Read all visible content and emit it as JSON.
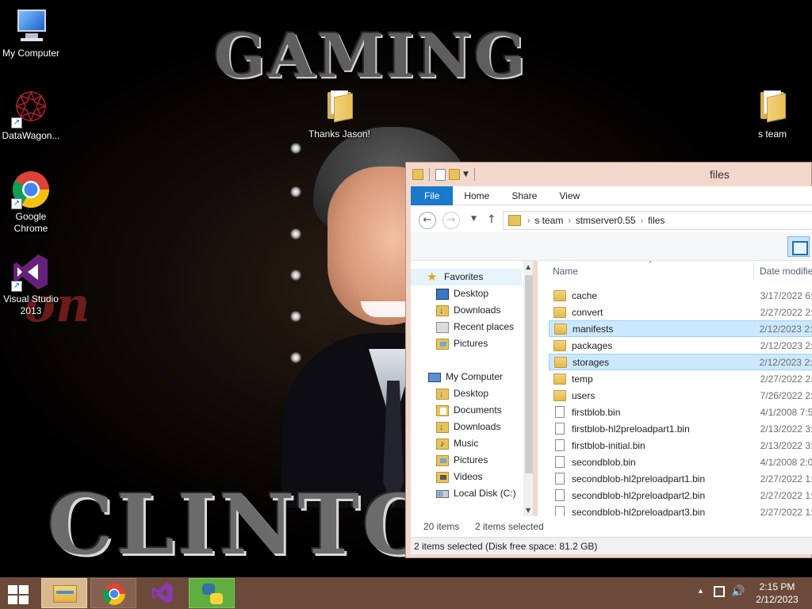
{
  "desktop": {
    "icons": [
      {
        "label": "My Computer",
        "icon": "my-computer-icon"
      },
      {
        "label": "DataWagon...",
        "icon": "datawagon-icon"
      },
      {
        "label": "Google Chrome",
        "icon": "chrome-icon"
      },
      {
        "label": "Visual Studio 2013",
        "icon": "visual-studio-icon"
      },
      {
        "label": "Thanks Jason!",
        "icon": "folder-icon"
      },
      {
        "label": "s team",
        "icon": "folder-icon"
      }
    ],
    "wallpaper_top_text": "GAMING",
    "wallpaper_bottom_text": "CLINTON TEAM",
    "wallpaper_script_text": "on"
  },
  "explorer": {
    "title": "files",
    "ribbon_tabs": [
      "File",
      "Home",
      "Share",
      "View"
    ],
    "breadcrumb": [
      "s team",
      "stmserver0.55",
      "files"
    ],
    "nav_pane": {
      "favorites_label": "Favorites",
      "favorites": [
        "Desktop",
        "Downloads",
        "Recent places",
        "Pictures"
      ],
      "computer_label": "My Computer",
      "computer": [
        "Desktop",
        "Documents",
        "Downloads",
        "Music",
        "Pictures",
        "Videos",
        "Local Disk (C:)"
      ]
    },
    "columns": {
      "name": "Name",
      "date": "Date modifie"
    },
    "files": [
      {
        "name": "cache",
        "date": "3/17/2022 6:3",
        "type": "folder",
        "selected": false
      },
      {
        "name": "convert",
        "date": "2/27/2022 2:1",
        "type": "folder",
        "selected": false
      },
      {
        "name": "manifests",
        "date": "2/12/2023 2:1",
        "type": "folder",
        "selected": true
      },
      {
        "name": "packages",
        "date": "2/12/2023 2:1",
        "type": "folder",
        "selected": false
      },
      {
        "name": "storages",
        "date": "2/12/2023 2:1",
        "type": "folder",
        "selected": true
      },
      {
        "name": "temp",
        "date": "2/27/2022 2:1",
        "type": "folder",
        "selected": false
      },
      {
        "name": "users",
        "date": "7/26/2022 2:4",
        "type": "folder",
        "selected": false
      },
      {
        "name": "firstblob.bin",
        "date": "4/1/2008 7:53",
        "type": "file",
        "selected": false
      },
      {
        "name": "firstblob-hl2preloadpart1.bin",
        "date": "2/13/2022 3:3",
        "type": "file",
        "selected": false
      },
      {
        "name": "firstblob-initial.bin",
        "date": "2/13/2022 3:3",
        "type": "file",
        "selected": false
      },
      {
        "name": "secondblob.bin",
        "date": "4/1/2008 2:01",
        "type": "file",
        "selected": false
      },
      {
        "name": "secondblob-hl2preloadpart1.bin",
        "date": "2/27/2022 1:2",
        "type": "file",
        "selected": false
      },
      {
        "name": "secondblob-hl2preloadpart2.bin",
        "date": "2/27/2022 1:2",
        "type": "file",
        "selected": false
      },
      {
        "name": "secondblob-hl2preloadpart3.bin",
        "date": "2/27/2022 1:2",
        "type": "file",
        "selected": false
      }
    ],
    "item_count": "20 items",
    "selected_count": "2 items selected",
    "status_bar": "2 items selected (Disk free space: 81.2 GB)"
  },
  "taskbar": {
    "apps": [
      {
        "name": "file-explorer",
        "active": true
      },
      {
        "name": "chrome",
        "active": false
      },
      {
        "name": "visual-studio",
        "active": false
      },
      {
        "name": "python",
        "active": false
      }
    ],
    "time": "2:15 PM",
    "date": "2/12/2023"
  }
}
